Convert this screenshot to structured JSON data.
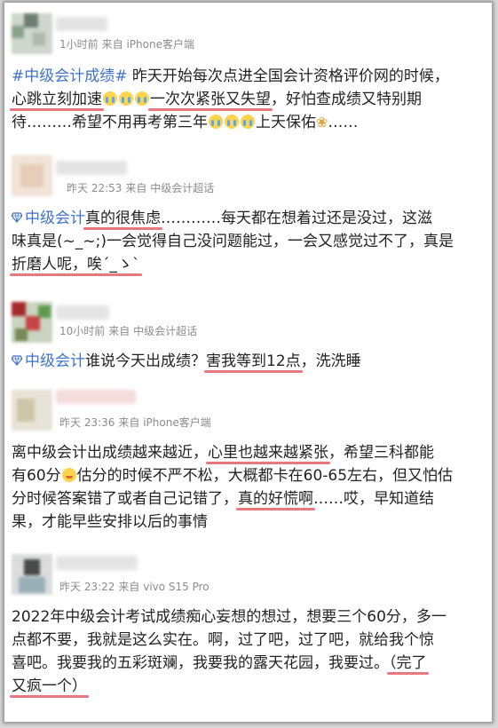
{
  "posts": [
    {
      "time": "1小时前",
      "source": "来自 iPhone客户端",
      "lines": [
        [
          {
            "t": "#中级会计成绩#",
            "c": "link"
          },
          {
            "t": " 昨天开始每次点进全国会计资格评价网的时候，"
          }
        ],
        [
          {
            "t": "心跳立刻加速",
            "u": true
          },
          {
            "e": "cry"
          },
          {
            "e": "cry"
          },
          {
            "e": "cry"
          },
          {
            "t": "一次次紧张又失望",
            "u": true
          },
          {
            "t": "，好怕查成绩又特别期"
          }
        ],
        [
          {
            "t": "待………希望不用再考第三年"
          },
          {
            "e": "cry"
          },
          {
            "e": "cry"
          },
          {
            "e": "cry"
          },
          {
            "t": "上天保佑"
          },
          {
            "e": "pray"
          },
          {
            "t": "……"
          }
        ]
      ]
    },
    {
      "time": "昨天 22:53",
      "source": "来自 中级会计超话",
      "lines": [
        [
          {
            "icon": "diamond"
          },
          {
            "t": "中级会计",
            "c": "link"
          },
          {
            "t": "真的很焦虑",
            "u": true
          },
          {
            "t": "…………每天都在想着过还是没过，这滋"
          }
        ],
        [
          {
            "t": "味真是(~_~;)一会觉得自己没问题能过，一会又感觉过不了，真是"
          }
        ],
        [
          {
            "t": "折磨人呢，唉´_ゝ`",
            "u": true
          }
        ]
      ]
    },
    {
      "time": "10小时前",
      "source": "来自 中级会计超话",
      "lines": [
        [
          {
            "icon": "diamond"
          },
          {
            "t": "中级会计",
            "c": "link"
          },
          {
            "t": "谁说今天出成绩？"
          },
          {
            "t": "害我等到12点",
            "u": true
          },
          {
            "t": "，洗洗睡"
          }
        ]
      ]
    },
    {
      "time": "昨天 23:36",
      "source": "来自 iPhone客户端",
      "lines": [
        [
          {
            "t": "离中级会计出成绩越来越近，"
          },
          {
            "t": "心里也越来越紧张",
            "u": true
          },
          {
            "t": "，希望三科都能"
          }
        ],
        [
          {
            "t": "有60分"
          },
          {
            "e": "blush"
          },
          {
            "t": "估分的时候不严不松，大概都卡在60-65左右，但又怕估"
          }
        ],
        [
          {
            "t": "分时候答案错了或者自己记错了，"
          },
          {
            "t": "真的好慌啊",
            "u": true
          },
          {
            "t": "……哎，早知道结"
          }
        ],
        [
          {
            "t": "果，才能早些安排以后的事情"
          }
        ]
      ]
    },
    {
      "time": "昨天 23:22",
      "source": "来自 vivo S15 Pro",
      "lines": [
        [
          {
            "t": "2022年中级会计考试成绩痴心妄想的想过，想要三个60分，多一"
          }
        ],
        [
          {
            "t": "点都不要，我就是这么实在。啊，过了吧，过了吧，就给我个惊"
          }
        ],
        [
          {
            "t": "喜吧。我要我的五彩斑斓，我要我的露天花园，我要过。"
          },
          {
            "t": "（完了",
            "u": true
          }
        ],
        [
          {
            "t": "又疯一个）",
            "u": true
          }
        ]
      ]
    }
  ],
  "colors": {
    "link": "#3f73c8",
    "underline": "#e8777f",
    "meta": "#8c8c8c",
    "text": "#222222"
  }
}
